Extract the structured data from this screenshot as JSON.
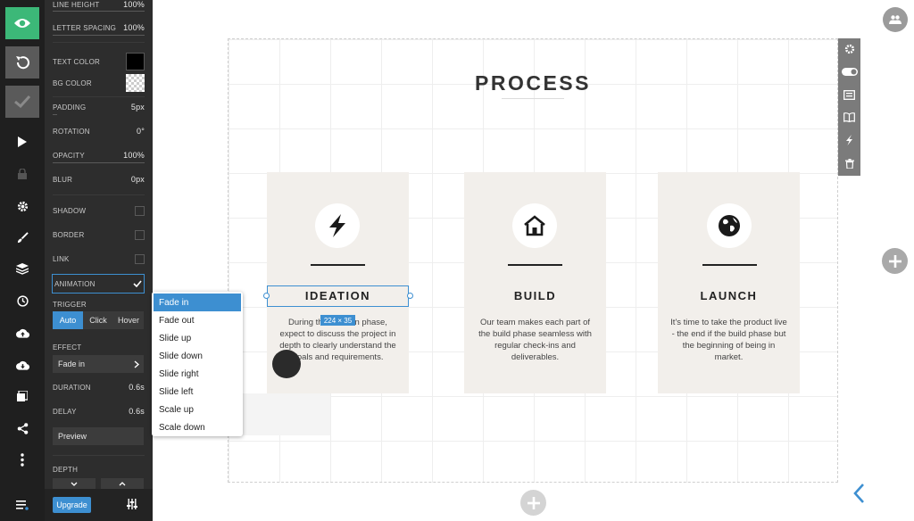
{
  "panel": {
    "line_height": {
      "label": "LINE HEIGHT",
      "value": "100%"
    },
    "letter_spacing": {
      "label": "LETTER SPACING",
      "value": "100%"
    },
    "text_color": {
      "label": "TEXT COLOR",
      "color": "#000000"
    },
    "bg_color": {
      "label": "BG COLOR"
    },
    "padding": {
      "label": "PADDING",
      "value": "5px"
    },
    "rotation": {
      "label": "ROTATION",
      "value": "0°"
    },
    "opacity": {
      "label": "OPACITY",
      "value": "100%"
    },
    "blur": {
      "label": "BLUR",
      "value": "0px"
    },
    "shadow": {
      "label": "SHADOW",
      "checked": false
    },
    "border": {
      "label": "BORDER",
      "checked": false
    },
    "link": {
      "label": "LINK",
      "checked": false
    },
    "animation": {
      "label": "ANIMATION",
      "checked": true
    },
    "trigger": {
      "label": "TRIGGER",
      "options": [
        "Auto",
        "Click",
        "Hover"
      ],
      "selected": "Auto"
    },
    "effect": {
      "label": "EFFECT",
      "value": "Fade in"
    },
    "duration": {
      "label": "DURATION",
      "value": "0.6s"
    },
    "delay": {
      "label": "DELAY",
      "value": "0.6s"
    },
    "preview_label": "Preview",
    "depth": {
      "label": "DEPTH"
    },
    "upgrade_label": "Upgrade"
  },
  "effect_dropdown": {
    "options": [
      "Fade in",
      "Fade out",
      "Slide up",
      "Slide down",
      "Slide right",
      "Slide left",
      "Scale up",
      "Scale down"
    ],
    "selected": "Fade in"
  },
  "canvas": {
    "heading": "PROCESS",
    "size_badge": "224 × 35",
    "cards": [
      {
        "title": "IDEATION",
        "icon": "lightning-icon",
        "lines": [
          "During the ideation phase,",
          "expect to discuss the project in",
          "depth to clearly understand the",
          "goals and requirements."
        ]
      },
      {
        "title": "BUILD",
        "icon": "house-icon",
        "lines": [
          "Our team makes each part of",
          "the build phase seamless with",
          "regular check-ins and",
          "deliverables."
        ]
      },
      {
        "title": "LAUNCH",
        "icon": "globe-icon",
        "lines": [
          "It's time to take the product live",
          "- the end if the build phase but",
          "the beginning of being in",
          "market."
        ]
      }
    ]
  },
  "colors": {
    "accent": "#3d8fd1",
    "preview_green": "#3cb878",
    "rail": "#1f1f1f",
    "panel": "#2d2d2d",
    "card_bg": "#f2efeb"
  }
}
